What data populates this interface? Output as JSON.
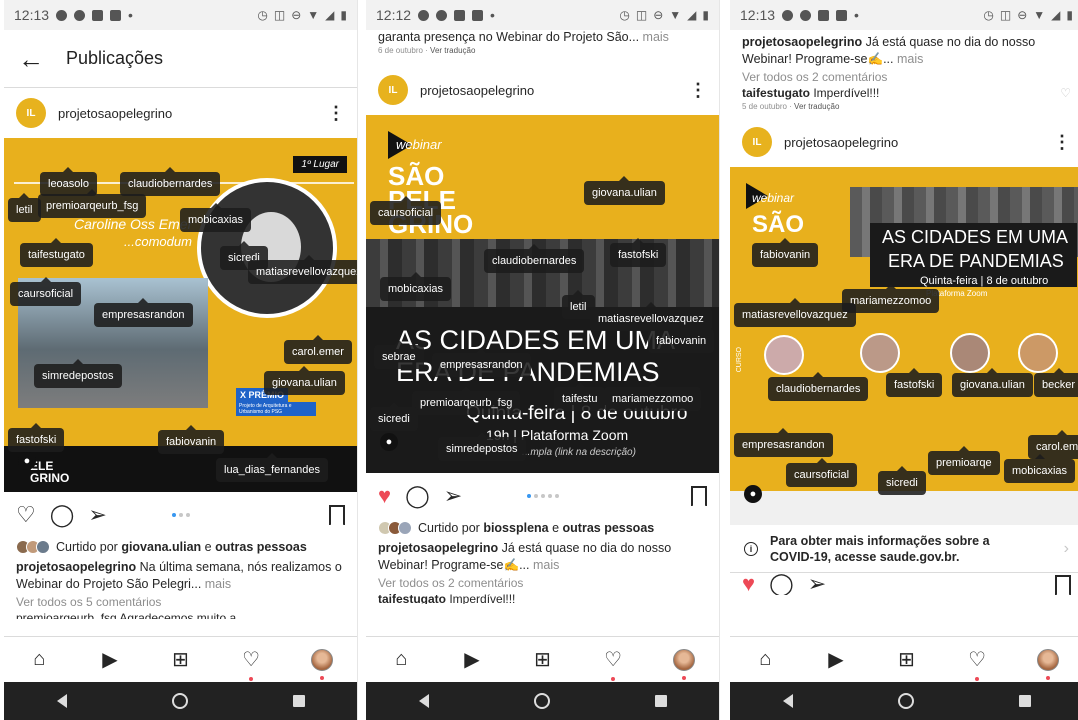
{
  "p1": {
    "status_time": "12:13",
    "appbar_title": "Publicações",
    "username": "projetosaopelegrino",
    "img": {
      "badge": "1º Lugar",
      "name_line1": "Caroline Oss Emer",
      "name_line2": "...comodum",
      "xpremio": "X PRÊMIO",
      "xpremio_sub": "Projeto de Arquitetura e Urbanismo do PSG",
      "logo_bottom": "ELE GRINO"
    },
    "tags": [
      "letil",
      "premioarqeurb_fsg",
      "claudiobernardes",
      "mobicaxias",
      "taifestugato",
      "sicredi",
      "matiasrevellovazquez",
      "caursoficial",
      "empresasrandon",
      "carol.emer",
      "simredepostos",
      "giovana.ulian",
      "fastofski",
      "fabiovanin",
      "lua_dias_fernandes",
      "leoasolo"
    ],
    "liked_by_prefix": "Curtido por ",
    "liked_user": "giovana.ulian",
    "liked_mid": " e ",
    "liked_others": "outras pessoas",
    "caption_user": "projetosaopelegrino",
    "caption_text": " Na última semana, nós realizamos o Webinar do Projeto São Pelegri...",
    "more": " mais",
    "view_comments": "Ver todos os 5 comentários",
    "peek": "premioarqeurb_fsg Agradecemos muito a"
  },
  "p2": {
    "status_time": "12:12",
    "top_caption": "garanta presença no Webinar do Projeto São...",
    "top_more": " mais",
    "date": "6 de outubro",
    "translate": "Ver tradução",
    "username": "projetosaopelegrino",
    "img": {
      "webinar": "webinar",
      "sao": "SÃO",
      "pele": "PELE",
      "grino": "GRINO",
      "title1": "AS CIDADES EM UMA",
      "title2": "ERA DE PANDEMIAS",
      "date_line": "Quinta-feira | 8 de outubro",
      "platform": "19h | Plataforma Zoom",
      "link": "...mpla (link na descrição)"
    },
    "tags": [
      "giovana.ulian",
      "caursoficial",
      "claudiobernardes",
      "fastofski",
      "mobicaxias",
      "letil",
      "matiasrevellovazquez",
      "fabiovanin",
      "sebrae",
      "empresasrandon",
      "taifestu",
      "mariamezzomoo",
      "premioarqeurb_fsg",
      "sicredi",
      "simredepostos"
    ],
    "liked_by_prefix": "Curtido por ",
    "liked_user": "biossplena",
    "liked_mid": " e ",
    "liked_others": "outras pessoas",
    "caption_user": "projetosaopelegrino",
    "caption_text": " Já está quase no dia do nosso Webinar! Programe-se✍...",
    "more": " mais",
    "view_comments": "Ver todos os 2 comentários",
    "peek_user": "taifestugato",
    "peek_text": " Imperdível!!!"
  },
  "p3": {
    "status_time": "12:13",
    "caption_user": "projetosaopelegrino",
    "caption_text": " Já está quase no dia do nosso Webinar! Programe-se✍...",
    "more": " mais",
    "view_comments": "Ver todos os 2 comentários",
    "comment_user": "taifestugato",
    "comment_text": " Imperdível!!!",
    "date": "5 de outubro",
    "translate": "Ver tradução",
    "username": "projetosaopelegrino",
    "img": {
      "webinar": "webinar",
      "sao": "SÃO",
      "title1": "AS CIDADES EM UMA",
      "title2": "ERA DE PANDEMIAS",
      "date_line": "Quinta-feira | 8 de outubro",
      "platform": "Plataforma Zoom",
      "curso": "CURSO"
    },
    "tags": [
      "fabiovanin",
      "mariamezzomoo",
      "matiasrevellovazquez",
      "claudiobernardes",
      "fastofski",
      "giovana.ulian",
      "becker",
      "empresasrandon",
      "caursoficial",
      "sicredi",
      "premioarqe",
      "mobicaxias",
      "carol.emer"
    ],
    "covid_line1": "Para obter mais informações sobre a",
    "covid_line2": "COVID-19, acesse saude.gov.br."
  },
  "colors": {
    "accent_yellow": "#e8b01d",
    "like_red": "#ed4956",
    "tag_bg": "#1c1c1c",
    "link_blue": "#3897f0"
  }
}
